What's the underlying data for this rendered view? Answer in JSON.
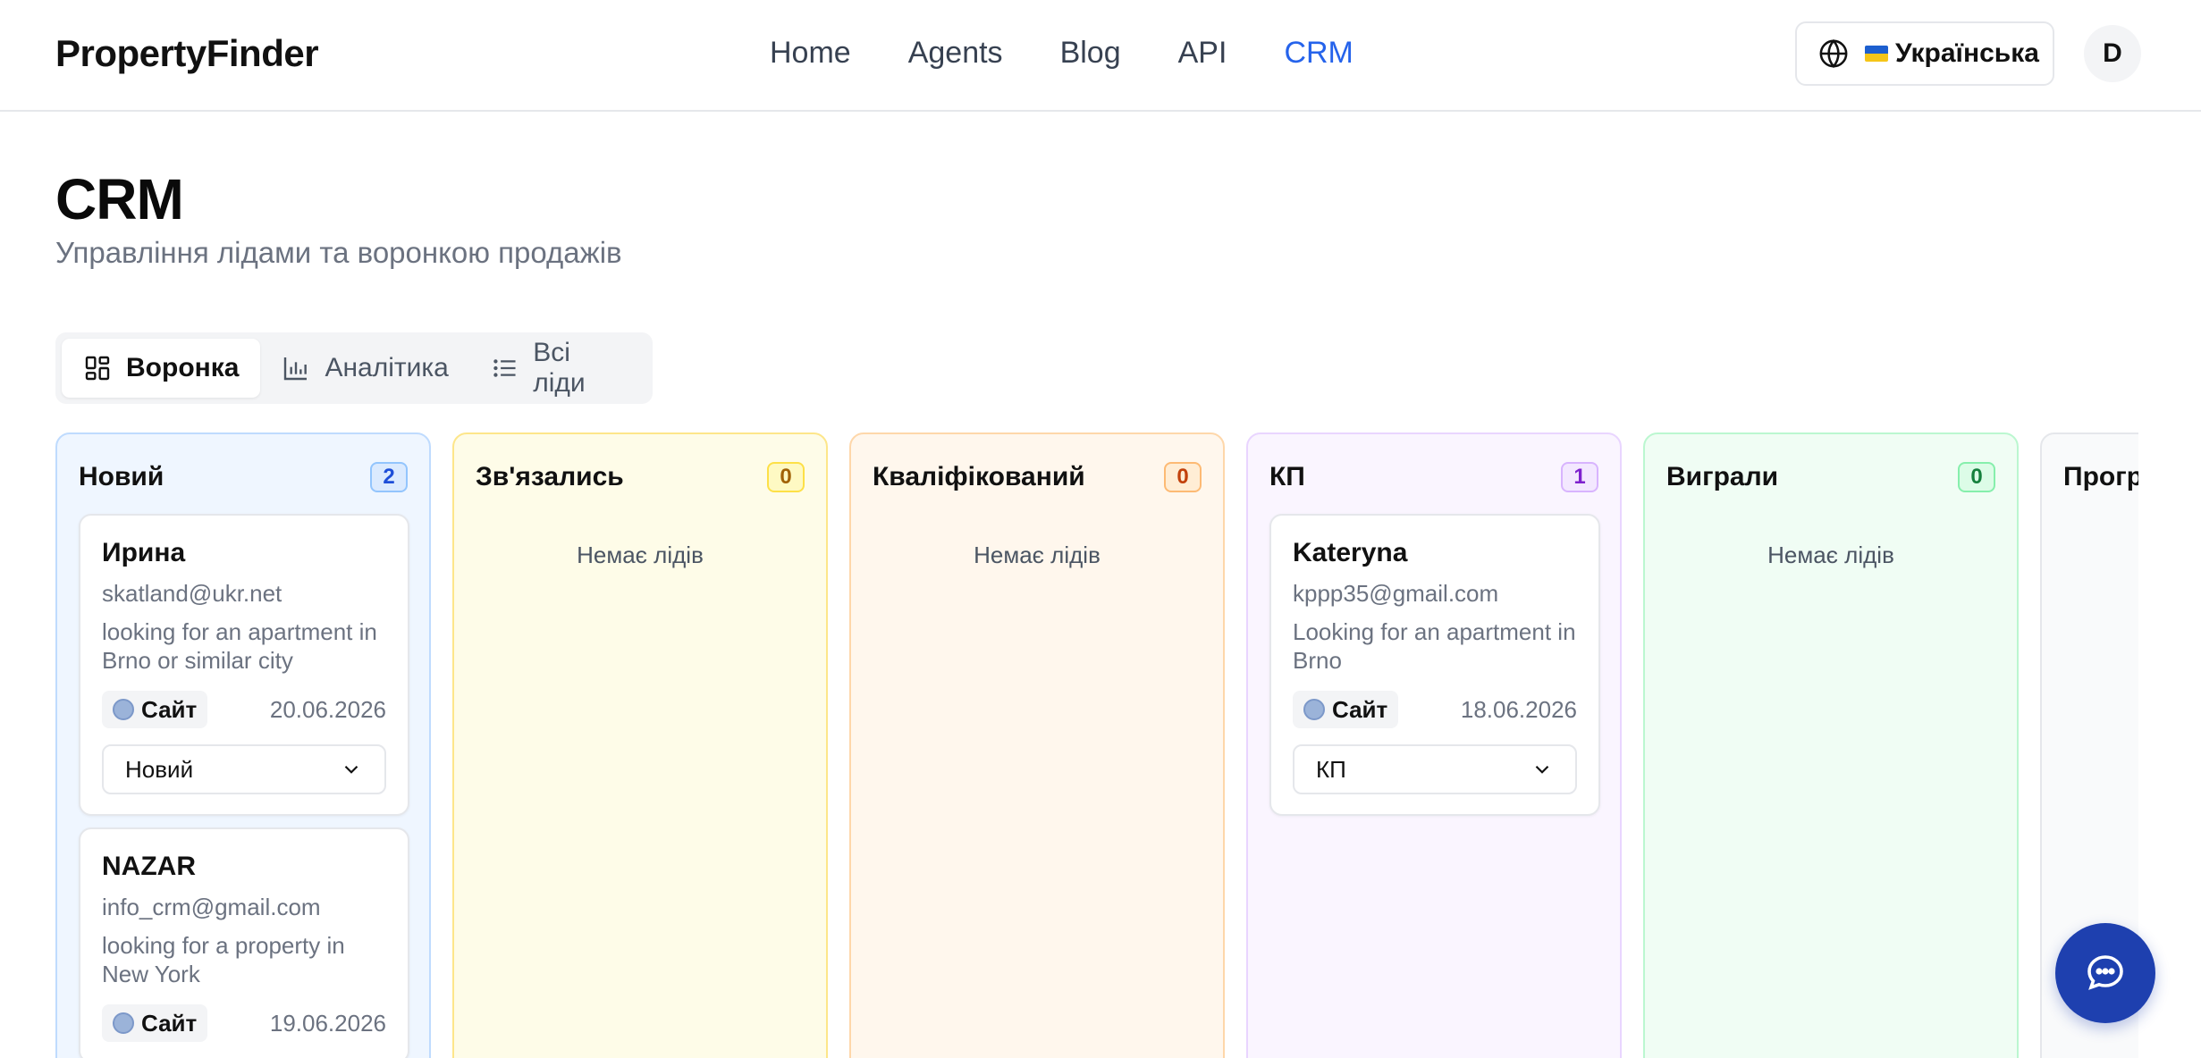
{
  "header": {
    "logo": "PropertyFinder",
    "nav": [
      "Home",
      "Agents",
      "Blog",
      "API",
      "CRM"
    ],
    "active_nav": "CRM",
    "language": "Українська",
    "avatar_initial": "D"
  },
  "page": {
    "title": "CRM",
    "subtitle": "Управління лідами та воронкою продажів"
  },
  "tabs": [
    {
      "label": "Воронка",
      "icon": "kanban-icon",
      "active": true
    },
    {
      "label": "Аналітика",
      "icon": "bar-chart-icon",
      "active": false
    },
    {
      "label": "Всі ліди",
      "icon": "list-icon",
      "active": false
    }
  ],
  "columns": [
    {
      "title": "Новий",
      "count": "2",
      "bg": "#eff6ff",
      "border": "#bfdbfe",
      "badge_bg": "#dbeafe",
      "badge_border": "#93c5fd",
      "badge_color": "#1d4ed8"
    },
    {
      "title": "Зв'язались",
      "count": "0",
      "bg": "#fefce8",
      "border": "#fde68a",
      "badge_bg": "#fef9c3",
      "badge_border": "#fde047",
      "badge_color": "#a16207",
      "empty": "Немає лідів"
    },
    {
      "title": "Кваліфікований",
      "count": "0",
      "bg": "#fff7ed",
      "border": "#fed7aa",
      "badge_bg": "#ffedd5",
      "badge_border": "#fdba74",
      "badge_color": "#c2410c",
      "empty": "Немає лідів"
    },
    {
      "title": "КП",
      "count": "1",
      "bg": "#faf5ff",
      "border": "#e9d5ff",
      "badge_bg": "#f3e8ff",
      "badge_border": "#d8b4fe",
      "badge_color": "#7e22ce"
    },
    {
      "title": "Виграли",
      "count": "0",
      "bg": "#f0fdf4",
      "border": "#bbf7d0",
      "badge_bg": "#dcfce7",
      "badge_border": "#86efac",
      "badge_color": "#15803d",
      "empty": "Немає лідів"
    },
    {
      "title": "Прогр",
      "bg": "#f9fafb",
      "border": "#e5e7eb"
    }
  ],
  "cards": [
    {
      "name": "Ирина",
      "email": "skatland@ukr.net",
      "message": "looking for an apartment in Brno or similar city",
      "source": "Сайт",
      "date": "20.06.2026",
      "status": "Новий"
    },
    {
      "name": "NAZAR",
      "email": "info_crm@gmail.com",
      "message": "looking for a property in New York",
      "source": "Сайт",
      "date": "19.06.2026"
    },
    {
      "name": "Kateryna",
      "email": "kppp35@gmail.com",
      "message": "Looking for an apartment in Brno",
      "source": "Сайт",
      "date": "18.06.2026",
      "status": "КП"
    }
  ]
}
